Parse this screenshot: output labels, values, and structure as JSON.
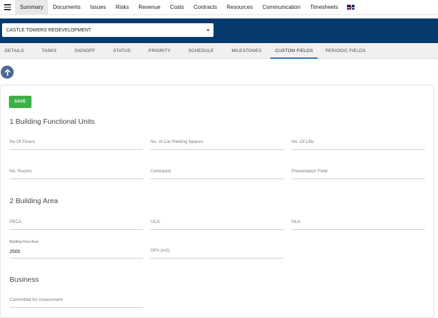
{
  "topnav": {
    "items": [
      "Summary",
      "Documents",
      "Issues",
      "Risks",
      "Revenue",
      "Costs",
      "Contracts",
      "Resources",
      "Communication",
      "Timesheets"
    ]
  },
  "project": {
    "selected": "CASTLE TOWERS REDEVELOPMENT"
  },
  "tabs": [
    "DETAILS",
    "TASKS",
    "SIGNOFF",
    "STATUS",
    "PRIORITY",
    "SCHEDULE",
    "MILESTONES",
    "CUSTOM FIELDS",
    "PERIODIC FIELDS"
  ],
  "form": {
    "save_label": "SAVE",
    "sections": [
      {
        "title": "1 Building Functional Units"
      },
      {
        "title": "2 Building Area"
      },
      {
        "title": "Business"
      }
    ],
    "fields": {
      "no_of_floors": "No Of Floors",
      "car_parking": "No. of Car Parking Spaces",
      "no_of_lifts": "No. Of Lifts",
      "no_rooms": "No. Rooms",
      "contractor": "Contractor",
      "presentation_field": "Presentation Field",
      "feca": "FECA",
      "uca": "UCA",
      "nla": "NLA",
      "building_floor_area_label": "Building Floor Area",
      "building_floor_area_value": "2500",
      "gfa": "GFA (m2)",
      "committed": "Committed for Assessment"
    }
  },
  "colors": {
    "header_blue": "#063a6e",
    "save_green": "#3db046",
    "active_tab": "#2c6fae"
  }
}
